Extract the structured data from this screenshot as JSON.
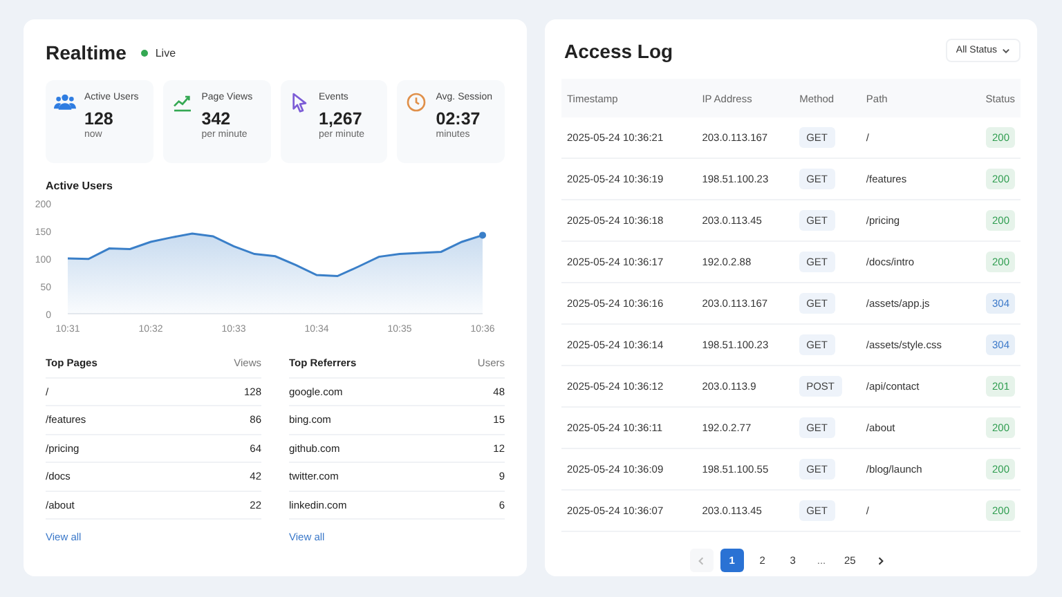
{
  "realtime": {
    "title": "Realtime",
    "live": {
      "label": "Live",
      "on": true
    },
    "stats": [
      {
        "kind": "users",
        "color": "#2f7de1",
        "label": "Active Users",
        "value": "128",
        "unit": "now"
      },
      {
        "kind": "trend",
        "color": "#34a853",
        "label": "Page Views",
        "value": "342",
        "unit": "per minute"
      },
      {
        "kind": "cursor",
        "color": "#7c5cd6",
        "label": "Events",
        "value": "1,267",
        "unit": "per minute"
      },
      {
        "kind": "clock",
        "color": "#e0904a",
        "label": "Avg. Session",
        "value": "02:37",
        "unit": "minutes"
      }
    ],
    "chart_title": "Active Users",
    "chart_data": {
      "type": "area",
      "categories": [
        "10:31",
        null,
        null,
        null,
        "10:32",
        null,
        null,
        null,
        "10:33",
        null,
        null,
        null,
        "10:34",
        null,
        null,
        null,
        "10:35",
        null,
        null,
        null,
        "10:36"
      ],
      "series": [
        {
          "color": "#3a7fc8",
          "values": [
            100,
            99,
            118,
            117,
            130,
            138,
            145,
            140,
            122,
            108,
            104,
            88,
            70,
            68,
            85,
            103,
            108,
            110,
            112,
            130,
            142
          ]
        }
      ],
      "ylim": [
        0,
        200
      ],
      "yticks": [
        0,
        50,
        100,
        150,
        200
      ]
    },
    "lists": [
      {
        "title": "Top Pages",
        "value_header": "Views",
        "rows": [
          {
            "name": "/",
            "value": "128"
          },
          {
            "name": "/features",
            "value": "86"
          },
          {
            "name": "/pricing",
            "value": "64"
          },
          {
            "name": "/docs",
            "value": "42"
          },
          {
            "name": "/about",
            "value": "22"
          }
        ],
        "link": "View all"
      },
      {
        "title": "Top Referrers",
        "value_header": "Users",
        "rows": [
          {
            "name": "google.com",
            "value": "48"
          },
          {
            "name": "bing.com",
            "value": "15"
          },
          {
            "name": "github.com",
            "value": "12"
          },
          {
            "name": "twitter.com",
            "value": "9"
          },
          {
            "name": "linkedin.com",
            "value": "6"
          }
        ],
        "link": "View all"
      }
    ]
  },
  "access_log": {
    "title": "Access Log",
    "filter": "All Status",
    "columns": [
      "Timestamp",
      "IP Address",
      "Method",
      "Path",
      "Status"
    ],
    "rows": [
      {
        "timestamp": "2025-05-24 10:36:21",
        "ip": "203.0.113.167",
        "method": "GET",
        "path": "/",
        "status": "200",
        "color": "#2e9d4f"
      },
      {
        "timestamp": "2025-05-24 10:36:19",
        "ip": "198.51.100.23",
        "method": "GET",
        "path": "/features",
        "status": "200",
        "color": "#2e9d4f"
      },
      {
        "timestamp": "2025-05-24 10:36:18",
        "ip": "203.0.113.45",
        "method": "GET",
        "path": "/pricing",
        "status": "200",
        "color": "#2e9d4f"
      },
      {
        "timestamp": "2025-05-24 10:36:17",
        "ip": "192.0.2.88",
        "method": "GET",
        "path": "/docs/intro",
        "status": "200",
        "color": "#2e9d4f"
      },
      {
        "timestamp": "2025-05-24 10:36:16",
        "ip": "203.0.113.167",
        "method": "GET",
        "path": "/assets/app.js",
        "status": "304",
        "color": "#3a78c9"
      },
      {
        "timestamp": "2025-05-24 10:36:14",
        "ip": "198.51.100.23",
        "method": "GET",
        "path": "/assets/style.css",
        "status": "304",
        "color": "#3a78c9"
      },
      {
        "timestamp": "2025-05-24 10:36:12",
        "ip": "203.0.113.9",
        "method": "POST",
        "path": "/api/contact",
        "status": "201",
        "color": "#2e9d4f"
      },
      {
        "timestamp": "2025-05-24 10:36:11",
        "ip": "192.0.2.77",
        "method": "GET",
        "path": "/about",
        "status": "200",
        "color": "#2e9d4f"
      },
      {
        "timestamp": "2025-05-24 10:36:09",
        "ip": "198.51.100.55",
        "method": "GET",
        "path": "/blog/launch",
        "status": "200",
        "color": "#2e9d4f"
      },
      {
        "timestamp": "2025-05-24 10:36:07",
        "ip": "203.0.113.45",
        "method": "GET",
        "path": "/",
        "status": "200",
        "color": "#2e9d4f"
      }
    ],
    "pagination": {
      "prev_disabled": true,
      "pages": [
        {
          "label": "1",
          "selected": true
        },
        {
          "label": "2",
          "selected": false
        },
        {
          "label": "3",
          "selected": false
        },
        {
          "label": "...",
          "kind": "gap"
        },
        {
          "label": "25",
          "selected": false
        }
      ]
    }
  }
}
